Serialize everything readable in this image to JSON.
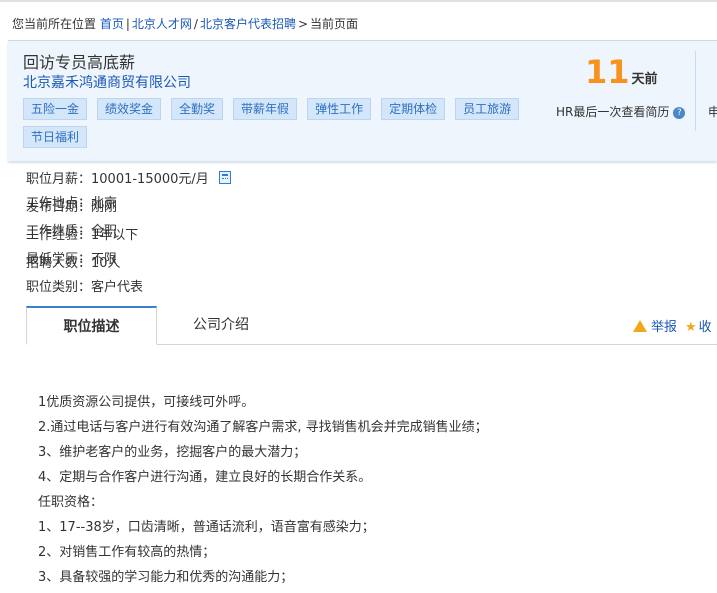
{
  "breadcrumb": {
    "prefix": "您当前所在位置",
    "items": [
      "首页",
      "北京人才网",
      "北京客户代表招聘"
    ],
    "current": "当前页面"
  },
  "job": {
    "title": "回访专员高底薪",
    "company": "北京嘉禾鸿通商贸有限公司",
    "tags": [
      "五险一金",
      "绩效奖金",
      "全勤奖",
      "带薪年假",
      "弹性工作",
      "定期体检",
      "员工旅游",
      "节日福利"
    ]
  },
  "activity": {
    "days": "11",
    "days_unit": "天前",
    "note": "HR最后一次查看简历",
    "help_icon": "question-icon",
    "cut_text": "申"
  },
  "info": {
    "salary_label": "职位月薪：",
    "salary_value": "10001-15000元/月",
    "location_label": "工作地点：",
    "location_value": "北京",
    "date_label": "发布日期：",
    "date_value": "刚刚",
    "nature_label": "工作性质：",
    "nature_value": "全职",
    "exp_label": "工作经验：",
    "exp_value": "1年以下",
    "edu_label": "最低学历：",
    "edu_value": "不限",
    "count_label": "招聘人数：",
    "count_value": "10人",
    "category_label": "职位类别：",
    "category_value": "客户代表"
  },
  "tabs": {
    "desc": "职位描述",
    "company": "公司介绍"
  },
  "actions": {
    "report": "举报",
    "collect": "收"
  },
  "description": [
    "1优质资源公司提供，可接线可外呼。",
    "2.通过电话与客户进行有效沟通了解客户需求, 寻找销售机会并完成销售业绩；",
    "3、维护老客户的业务，挖掘客户的最大潜力；",
    "4、定期与合作客户进行沟通，建立良好的长期合作关系。",
    "任职资格：",
    "1、17--38岁，口齿清晰，普通话流利，语音富有感染力；",
    "2、对销售工作有较高的热情；",
    "3、具备较强的学习能力和优秀的沟通能力；"
  ],
  "colors": {
    "link": "#1a58b8",
    "accent": "#f7921e",
    "tag_bg": "#d4e6fa"
  }
}
